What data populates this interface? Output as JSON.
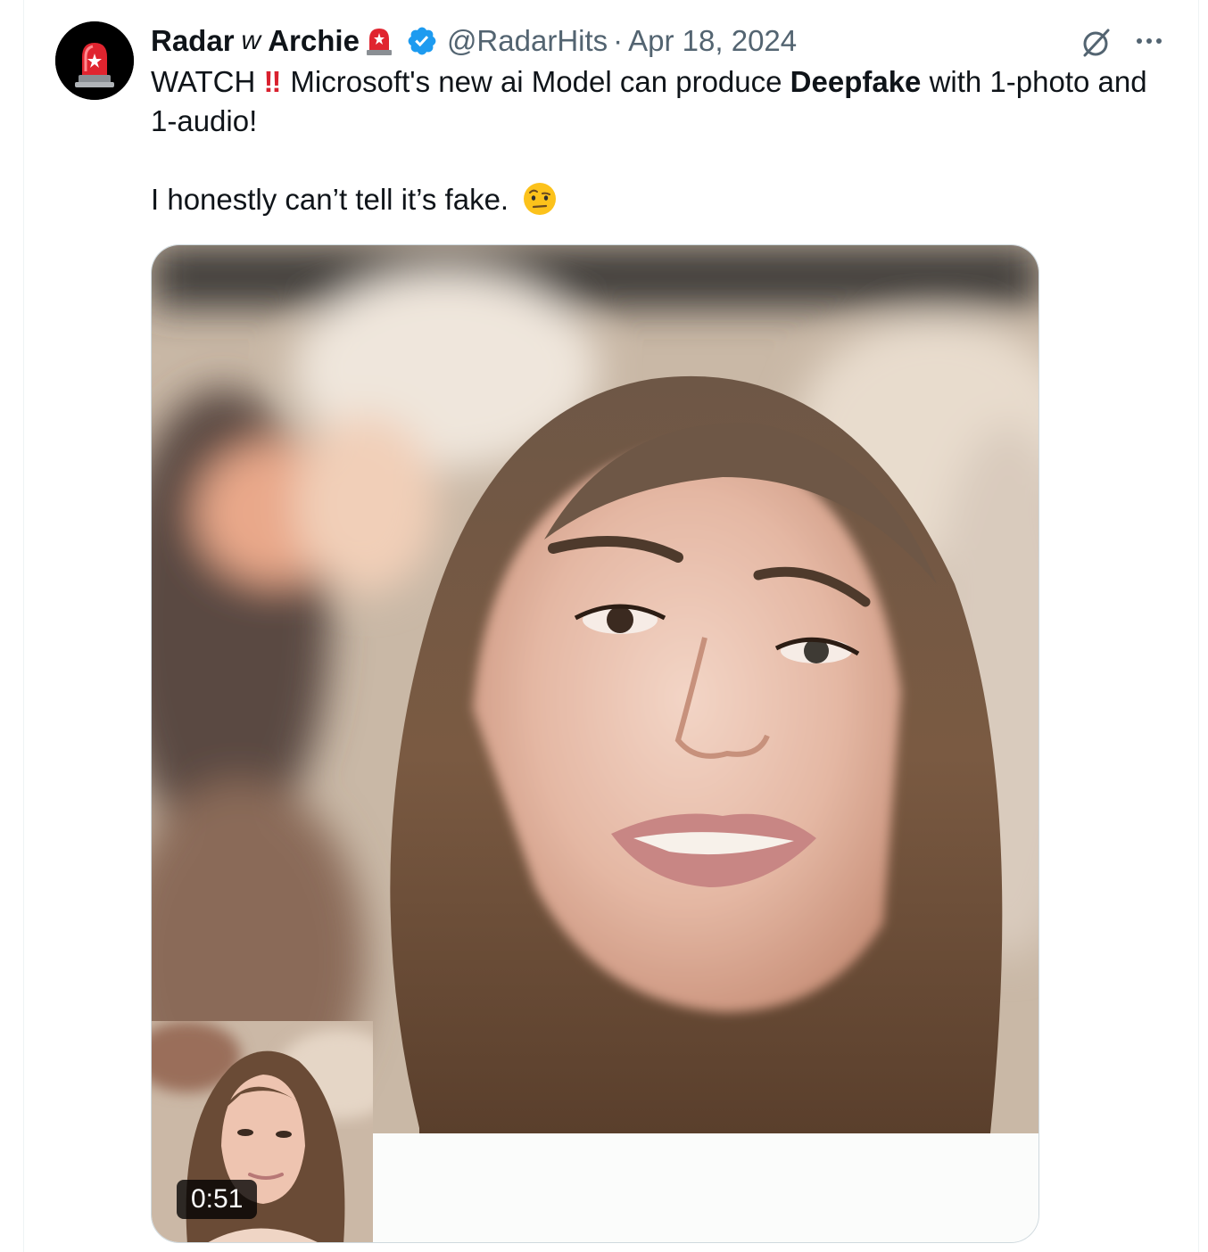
{
  "author": {
    "name_part1": "Radar",
    "name_mid": "w",
    "name_part2": "Archie",
    "handle": "@RadarHits",
    "separator": "·",
    "date": "Apr 18, 2024",
    "avatar_icon": "siren-icon",
    "verified_color": "#1d9bf0"
  },
  "tweet": {
    "line1_prefix": "WATCH",
    "line1_bang": "‼",
    "line1_text_a": "Microsoft's new ai Model can produce ",
    "line1_bold": "Deepfake",
    "line1_text_b": " with 1-photo and 1-audio!",
    "line2": "I honestly can’t tell it’s fake.",
    "emoji": "face-with-raised-eyebrow-icon"
  },
  "media": {
    "type": "video",
    "duration": "0:51"
  },
  "actions": {
    "grok_icon": "grok-icon",
    "more_icon": "more-options-icon"
  },
  "colors": {
    "text": "#0f1419",
    "secondary": "#536471",
    "border": "#cfd9de",
    "bang": "#d9202e"
  }
}
